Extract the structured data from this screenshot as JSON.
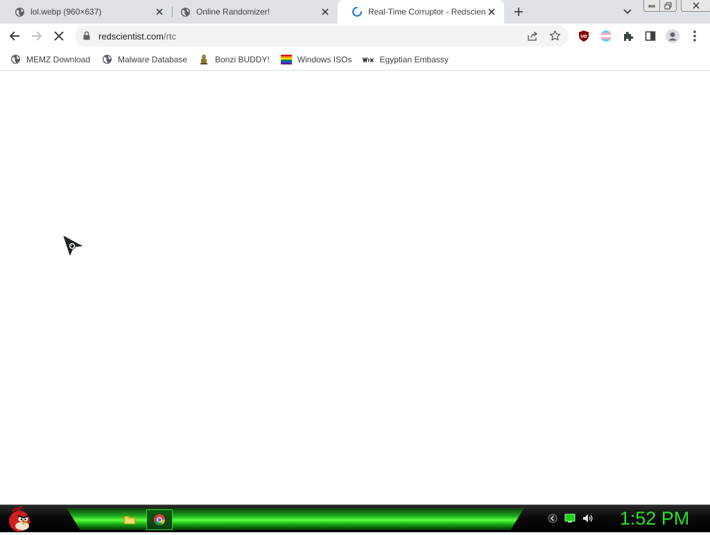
{
  "tabs": [
    {
      "title": "lol.webp (960×637)",
      "active": false,
      "favicon": "globe-icon"
    },
    {
      "title": "Online Randomizer!",
      "active": false,
      "favicon": "globe-icon"
    },
    {
      "title": "Real-Time Corruptor - Redscientist",
      "active": true,
      "favicon": "loading-spinner-icon"
    }
  ],
  "address_bar": {
    "domain": "redscientist.com",
    "path": "/rtc"
  },
  "bookmarks": [
    {
      "label": "MEMZ Download",
      "icon": "globe-icon"
    },
    {
      "label": "Malware Database",
      "icon": "globe-icon"
    },
    {
      "label": "Bonzi BUDDY!",
      "icon": "bonzi-icon"
    },
    {
      "label": "Windows ISOs",
      "icon": "rainbow-flag-icon"
    },
    {
      "label": "Egyptian Embassy",
      "icon": "wix-icon"
    }
  ],
  "taskbar": {
    "clock": "1:52 PM",
    "accent_color": "#25e425"
  }
}
